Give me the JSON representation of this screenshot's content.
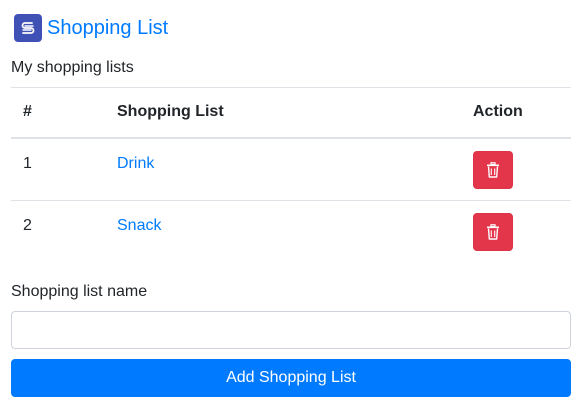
{
  "header": {
    "logo_icon": "app-logo-icon",
    "title": "Shopping List",
    "brand_color": "#3f51b5",
    "link_color": "#007bff"
  },
  "subtitle": "My shopping lists",
  "table": {
    "headers": {
      "number": "#",
      "name": "Shopping List",
      "action": "Action"
    },
    "rows": [
      {
        "number": "1",
        "name": "Drink",
        "action_icon": "trash-icon"
      },
      {
        "number": "2",
        "name": "Snack",
        "action_icon": "trash-icon"
      }
    ],
    "delete_color": "#e4364a"
  },
  "form": {
    "label": "Shopping list name",
    "input_value": "",
    "input_placeholder": "",
    "submit_label": "Add Shopping List",
    "submit_color": "#007bff"
  }
}
